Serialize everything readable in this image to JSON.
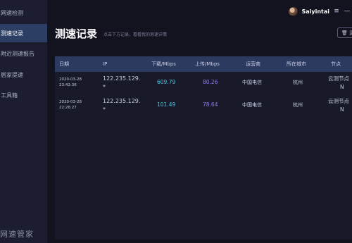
{
  "sidebar": {
    "items": [
      {
        "label": "网速检测"
      },
      {
        "label": "测速记录"
      },
      {
        "label": "附近测速报告"
      },
      {
        "label": "居家提速"
      },
      {
        "label": "工具箱"
      }
    ],
    "active_index": 1,
    "logo_text": "网速管家"
  },
  "header": {
    "username": "Saiyintai",
    "menu_icon": "≡",
    "minimize_icon": "—"
  },
  "page": {
    "title": "测速记录",
    "hint": "点击下方记录，看看我的测速详情",
    "clear_label": "🗑 清"
  },
  "table": {
    "columns": [
      "日期",
      "IP",
      "下载/Mbps",
      "上传/Mbps",
      "运营商",
      "所在城市",
      "节点"
    ],
    "rows": [
      {
        "date": "2020-03-28",
        "time": "23:42:36",
        "ip": "122.235.129.",
        "ip2": "*",
        "download": "609.79",
        "upload": "80.26",
        "isp": "中国电信",
        "city": "杭州",
        "node": "云测节点",
        "node2": "N"
      },
      {
        "date": "2020-03-28",
        "time": "22:26:27",
        "ip": "122.235.129.",
        "ip2": "*",
        "download": "101.49",
        "upload": "78.64",
        "isp": "中国电信",
        "city": "杭州",
        "node": "云测节点",
        "node2": "N"
      }
    ]
  },
  "colors": {
    "download": "#4fc3e0",
    "upload": "#8e7cf0",
    "active_nav": "#2c3e64"
  }
}
